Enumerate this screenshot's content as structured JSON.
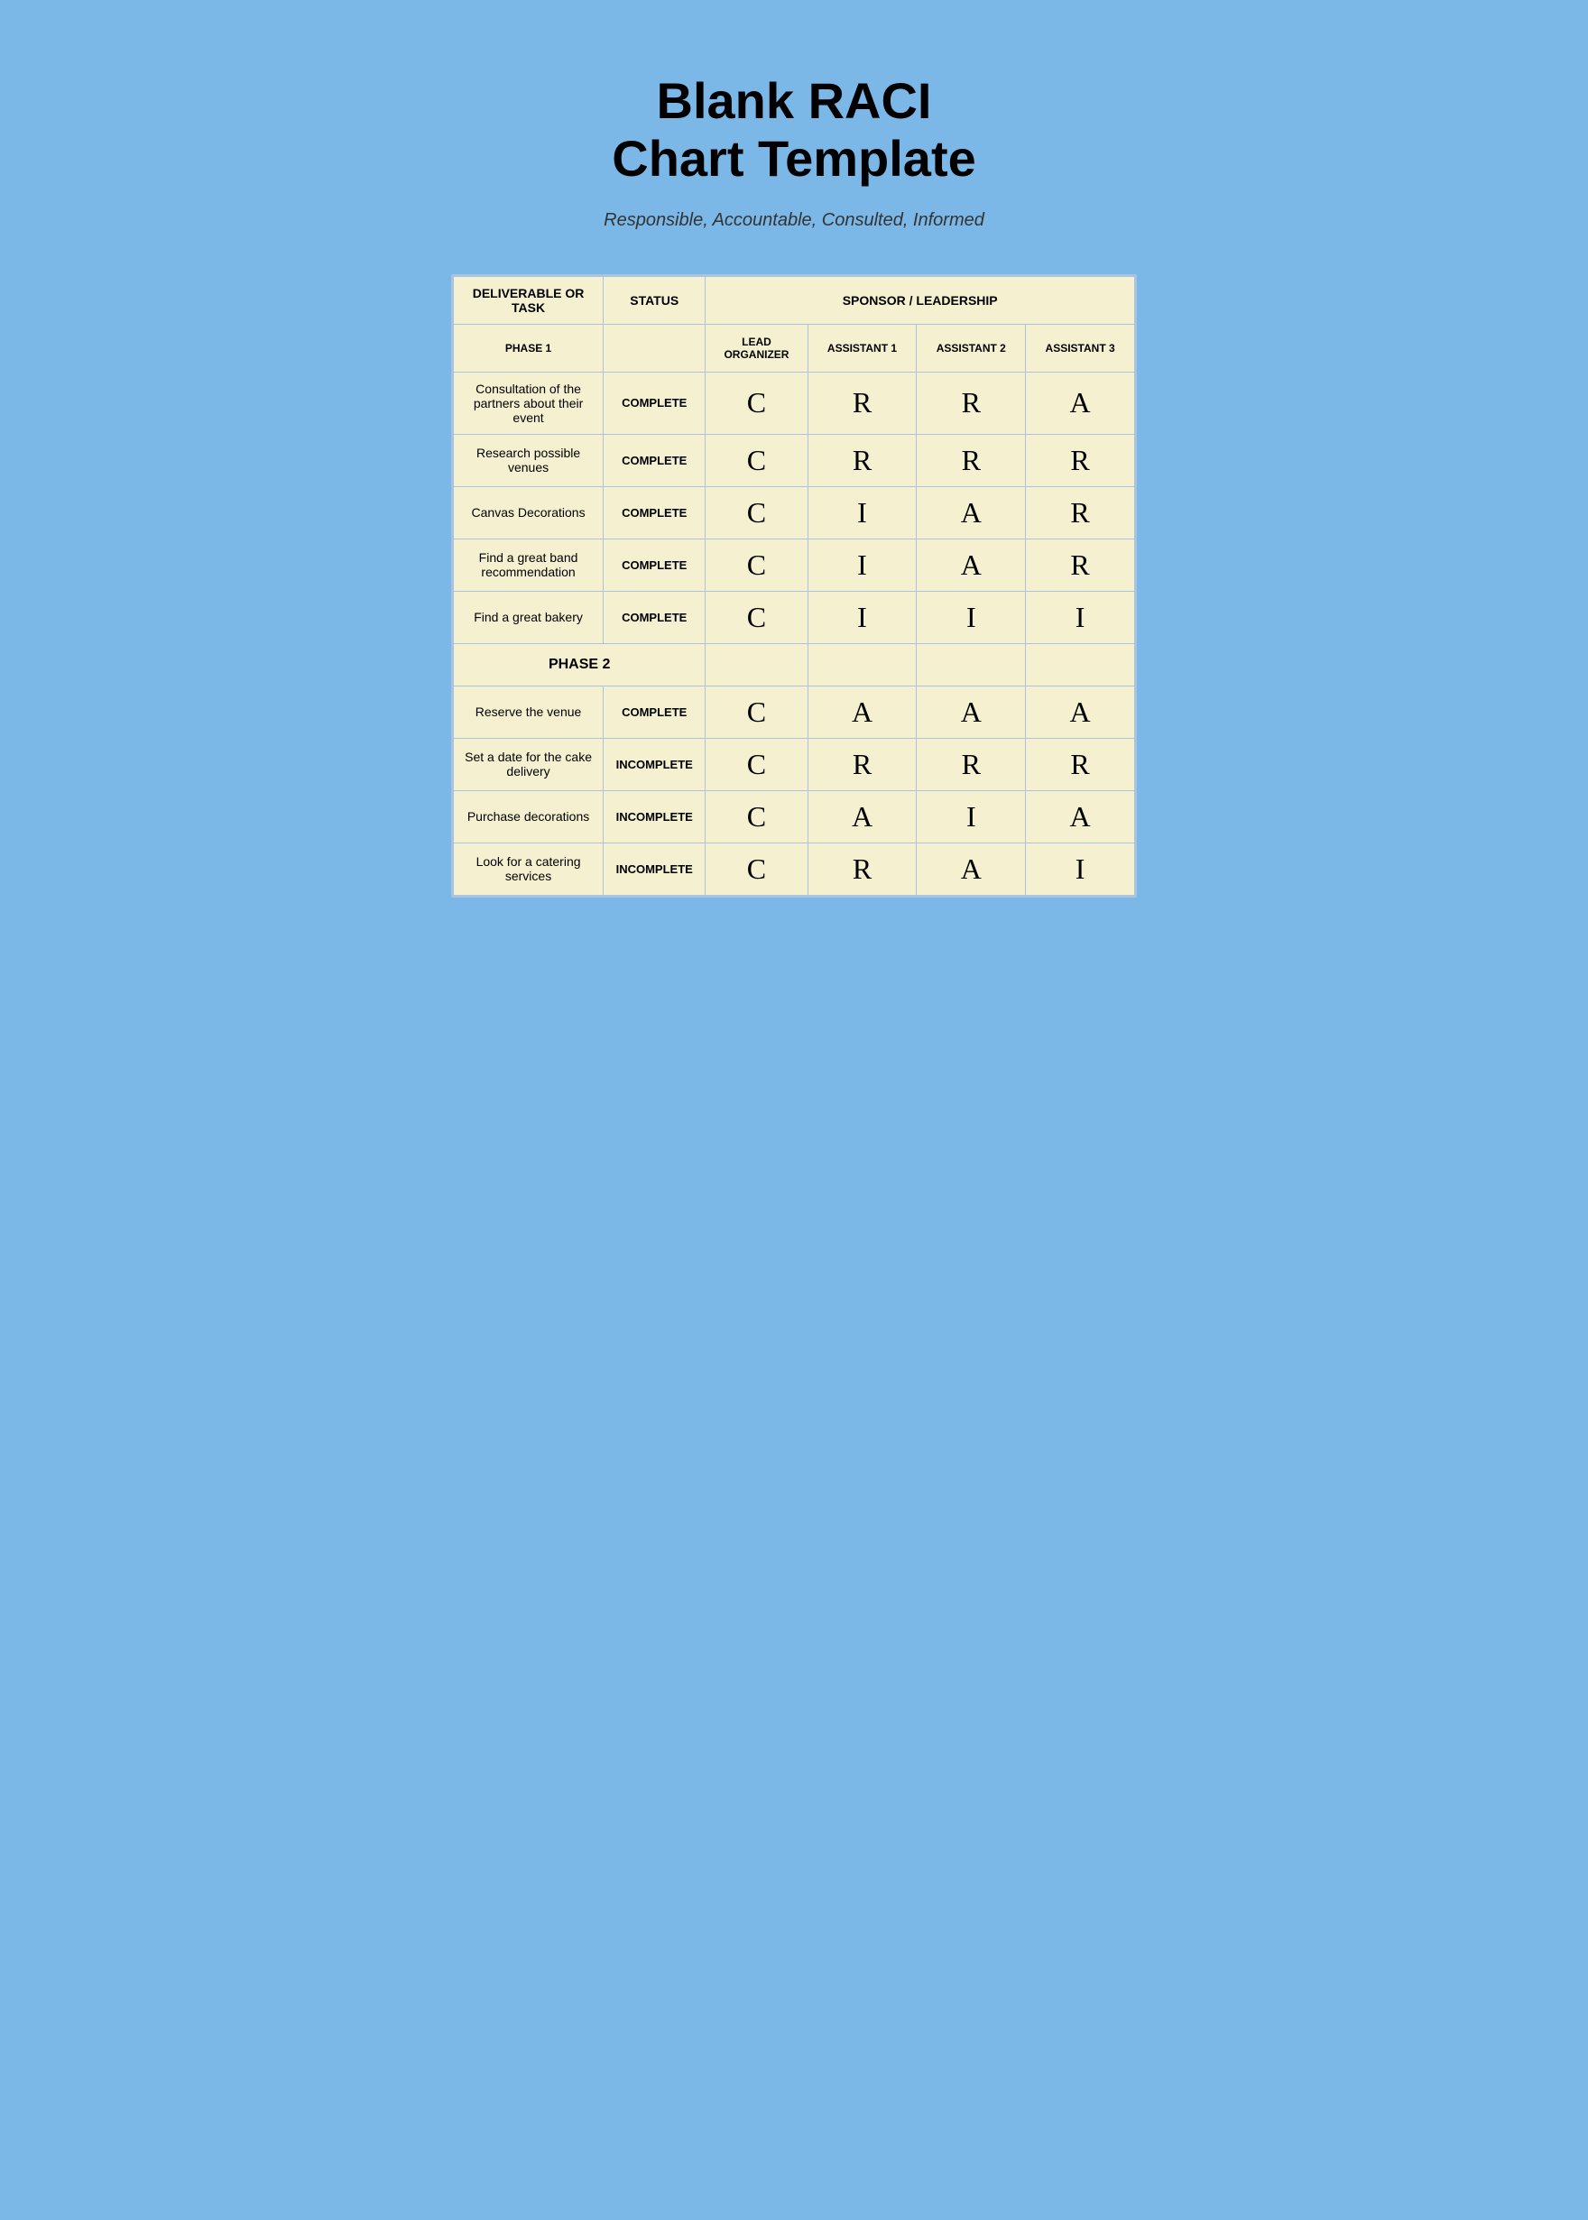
{
  "title": {
    "line1": "Blank RACI",
    "line2": "Chart Template"
  },
  "subtitle": "Responsible, Accountable, Consulted, Informed",
  "table": {
    "headers": {
      "deliverable": "DELIVERABLE OR TASK",
      "status": "STATUS",
      "sponsorLeadership": "SPONSOR / LEADERSHIP"
    },
    "subheaders": {
      "leadOrganizer": "LEAD ORGANIZER",
      "assistant1": "ASSISTANT 1",
      "assistant2": "ASSISTANT 2",
      "assistant3": "ASSISTANT 3"
    },
    "phases": [
      {
        "label": "PHASE 1",
        "rows": [
          {
            "task": "Consultation of the partners about their event",
            "status": "COMPLETE",
            "lead": "C",
            "a1": "R",
            "a2": "R",
            "a3": "A"
          },
          {
            "task": "Research possible venues",
            "status": "COMPLETE",
            "lead": "C",
            "a1": "R",
            "a2": "R",
            "a3": "R"
          },
          {
            "task": "Canvas Decorations",
            "status": "COMPLETE",
            "lead": "C",
            "a1": "I",
            "a2": "A",
            "a3": "R"
          },
          {
            "task": "Find a great band recommendation",
            "status": "COMPLETE",
            "lead": "C",
            "a1": "I",
            "a2": "A",
            "a3": "R"
          },
          {
            "task": "Find a great bakery",
            "status": "COMPLETE",
            "lead": "C",
            "a1": "I",
            "a2": "I",
            "a3": "I"
          }
        ]
      },
      {
        "label": "PHASE 2",
        "rows": [
          {
            "task": "Reserve the venue",
            "status": "COMPLETE",
            "lead": "C",
            "a1": "A",
            "a2": "A",
            "a3": "A"
          },
          {
            "task": "Set a date for the cake delivery",
            "status": "INCOMPLETE",
            "lead": "C",
            "a1": "R",
            "a2": "R",
            "a3": "R"
          },
          {
            "task": "Purchase decorations",
            "status": "INCOMPLETE",
            "lead": "C",
            "a1": "A",
            "a2": "I",
            "a3": "A"
          },
          {
            "task": "Look for a catering services",
            "status": "INCOMPLETE",
            "lead": "C",
            "a1": "R",
            "a2": "A",
            "a3": "I"
          }
        ]
      }
    ]
  }
}
